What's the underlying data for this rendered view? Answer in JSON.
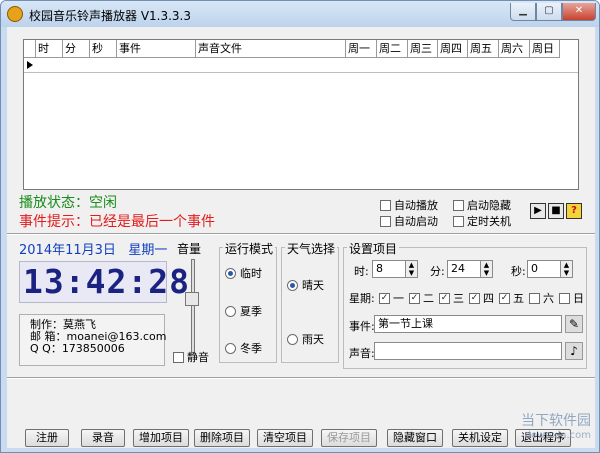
{
  "window": {
    "title": "校园音乐铃声播放器 V1.3.3.3"
  },
  "grid": {
    "columns": [
      "时",
      "分",
      "秒",
      "事件",
      "声音文件",
      "周一",
      "周二",
      "周三",
      "周四",
      "周五",
      "周六",
      "周日"
    ]
  },
  "status": {
    "play": "播放状态：空闲",
    "event": "事件提示：已经是最后一个事件"
  },
  "options": [
    {
      "label": "自动播放",
      "checked": false
    },
    {
      "label": "启动隐藏",
      "checked": false
    },
    {
      "label": "自动启动",
      "checked": false
    },
    {
      "label": "定时关机",
      "checked": false
    }
  ],
  "clock": {
    "date": "2014年11月3日",
    "weekday": "星期一",
    "time": "13:42:28"
  },
  "info": {
    "maker": "制作：莫燕飞",
    "email": "邮 箱：moanei@163.com",
    "qq": "Q Q：173850006"
  },
  "volume": {
    "title": "音量",
    "mute_label": "静音",
    "mute_checked": false,
    "level": 0.6
  },
  "run_mode": {
    "title": "运行模式",
    "options": [
      "临时",
      "夏季",
      "冬季"
    ],
    "selected": 0
  },
  "weather": {
    "title": "天气选择",
    "options": [
      "晴天",
      "雨天"
    ],
    "selected": 0
  },
  "settings": {
    "title": "设置项目",
    "hour_label": "时:",
    "hour": "8",
    "minute_label": "分:",
    "minute": "24",
    "second_label": "秒:",
    "second": "0",
    "week_label": "星期:",
    "weekdays": [
      {
        "label": "一",
        "checked": true
      },
      {
        "label": "二",
        "checked": true
      },
      {
        "label": "三",
        "checked": true
      },
      {
        "label": "四",
        "checked": true
      },
      {
        "label": "五",
        "checked": true
      },
      {
        "label": "六",
        "checked": false
      },
      {
        "label": "日",
        "checked": false
      }
    ],
    "event_label": "事件:",
    "event_value": "第一节上课",
    "sound_label": "声音:",
    "sound_value": ""
  },
  "buttons": [
    "注册",
    "录音",
    "增加项目",
    "删除项目",
    "清空项目",
    "保存项目",
    "隐藏窗口",
    "关机设定",
    "退出程序"
  ],
  "watermark": {
    "line1": "当下软件园",
    "line2": "downxia.com"
  }
}
